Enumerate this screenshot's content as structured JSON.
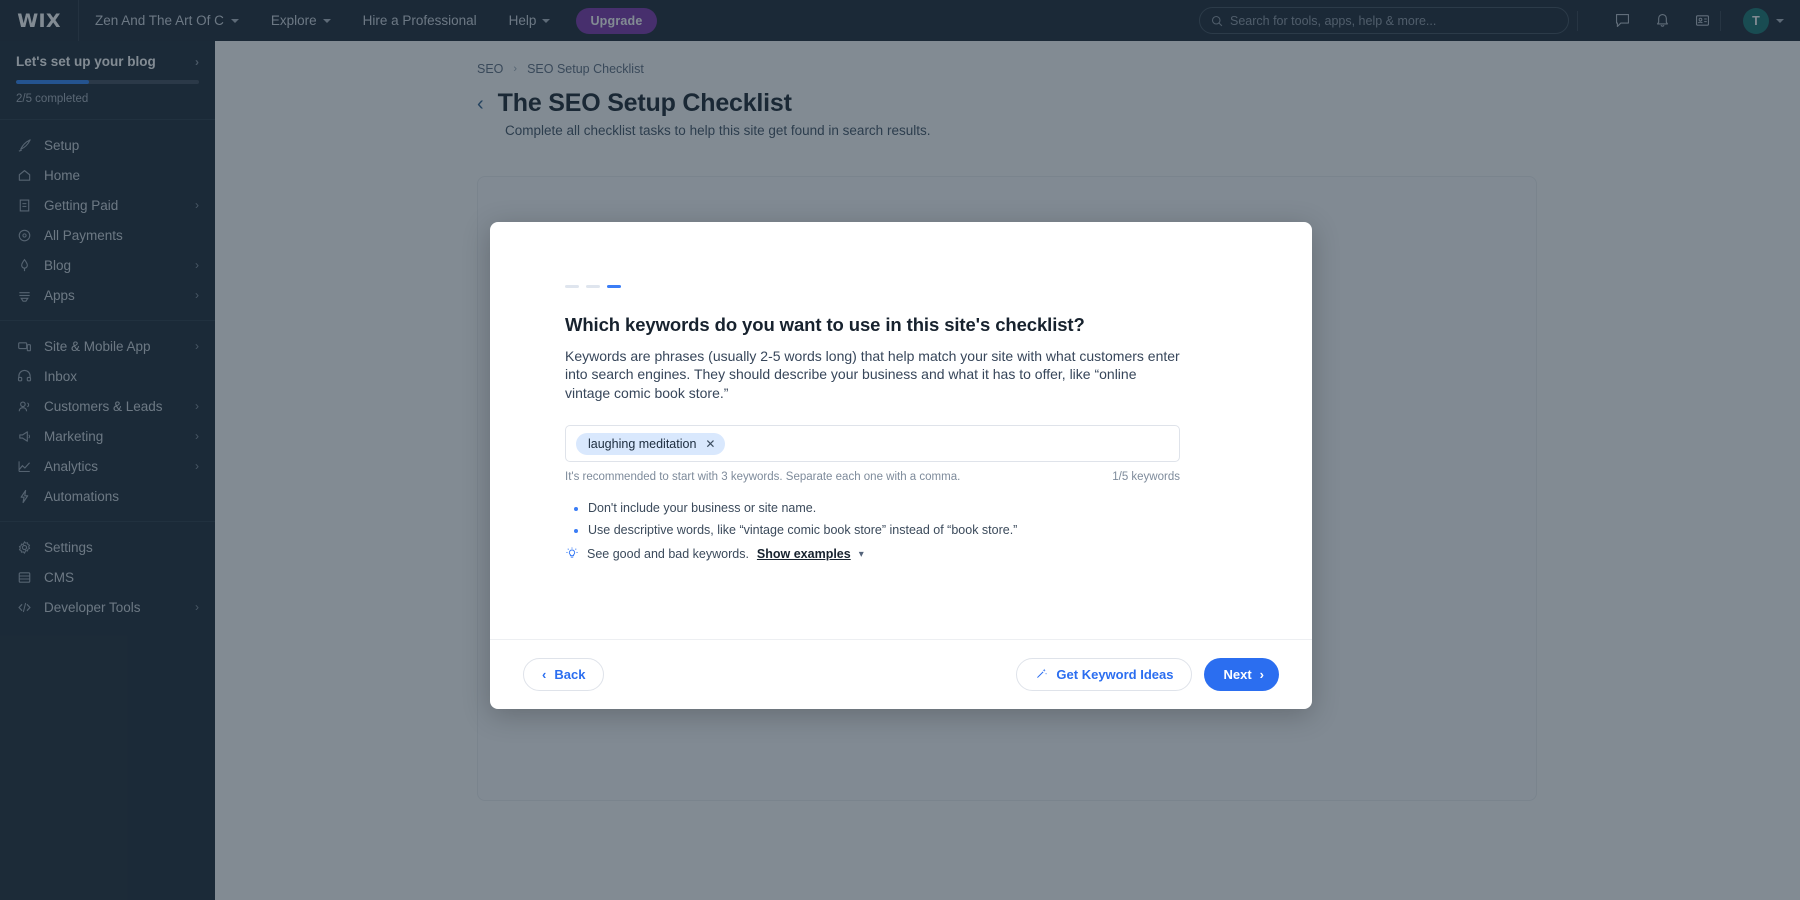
{
  "topbar": {
    "logo": "WIX",
    "site_name": "Zen And The Art Of C",
    "links": [
      {
        "label": "Explore",
        "has_caret": true
      },
      {
        "label": "Hire a Professional",
        "has_caret": false
      },
      {
        "label": "Help",
        "has_caret": true
      }
    ],
    "upgrade_label": "Upgrade",
    "search_placeholder": "Search for tools, apps, help & more...",
    "icons": [
      "chat-icon",
      "notifications-bell-icon",
      "contact-card-icon"
    ],
    "avatar_initial": "T"
  },
  "sidebar": {
    "setup": {
      "title": "Let's set up your blog",
      "progress_label": "2/5 completed",
      "progress_percent": 40,
      "accent": "#2b7ff5"
    },
    "groups": [
      {
        "items": [
          {
            "label": "Setup",
            "icon": "rocket-icon",
            "chevron": false
          },
          {
            "label": "Home",
            "icon": "home-icon",
            "chevron": false
          },
          {
            "label": "Getting Paid",
            "icon": "invoice-icon",
            "chevron": true
          },
          {
            "label": "All Payments",
            "icon": "coin-icon",
            "chevron": false
          },
          {
            "label": "Blog",
            "icon": "pen-icon",
            "chevron": true
          },
          {
            "label": "Apps",
            "icon": "apps-icon",
            "chevron": true
          }
        ]
      },
      {
        "items": [
          {
            "label": "Site & Mobile App",
            "icon": "device-icon",
            "chevron": true
          },
          {
            "label": "Inbox",
            "icon": "inbox-icon",
            "chevron": false
          },
          {
            "label": "Customers & Leads",
            "icon": "people-icon",
            "chevron": true
          },
          {
            "label": "Marketing",
            "icon": "megaphone-icon",
            "chevron": true
          },
          {
            "label": "Analytics",
            "icon": "chart-icon",
            "chevron": true
          },
          {
            "label": "Automations",
            "icon": "bolt-icon",
            "chevron": false
          }
        ]
      },
      {
        "items": [
          {
            "label": "Settings",
            "icon": "gear-icon",
            "chevron": false
          },
          {
            "label": "CMS",
            "icon": "database-icon",
            "chevron": false
          },
          {
            "label": "Developer Tools",
            "icon": "code-icon",
            "chevron": true
          }
        ]
      }
    ]
  },
  "page": {
    "breadcrumb": [
      "SEO",
      "SEO Setup Checklist"
    ],
    "title": "The SEO Setup Checklist",
    "subtitle": "Complete all checklist tasks to help this site get found in search results."
  },
  "modal": {
    "steps": [
      {
        "active": false
      },
      {
        "active": false
      },
      {
        "active": true
      }
    ],
    "title": "Which keywords do you want to use in this site's checklist?",
    "description": "Keywords are phrases (usually 2-5 words long) that help match your site with what customers enter into search engines. They should describe your business and what it has to offer, like “online vintage comic book store.”",
    "keywords": [
      "laughing meditation"
    ],
    "input_placeholder": "",
    "hint": "It's recommended to start with 3 keywords. Separate each one with a comma.",
    "counter": "1/5 keywords",
    "bullets": [
      "Don't include your business or site name.",
      "Use descriptive words, like “vintage comic book store” instead of “book store.”"
    ],
    "tip_text": "See good and bad keywords.",
    "tip_link": "Show examples",
    "footer": {
      "back_label": "Back",
      "keyword_ideas_label": "Get Keyword Ideas",
      "next_label": "Next"
    },
    "accent": "#2b6ef0"
  }
}
